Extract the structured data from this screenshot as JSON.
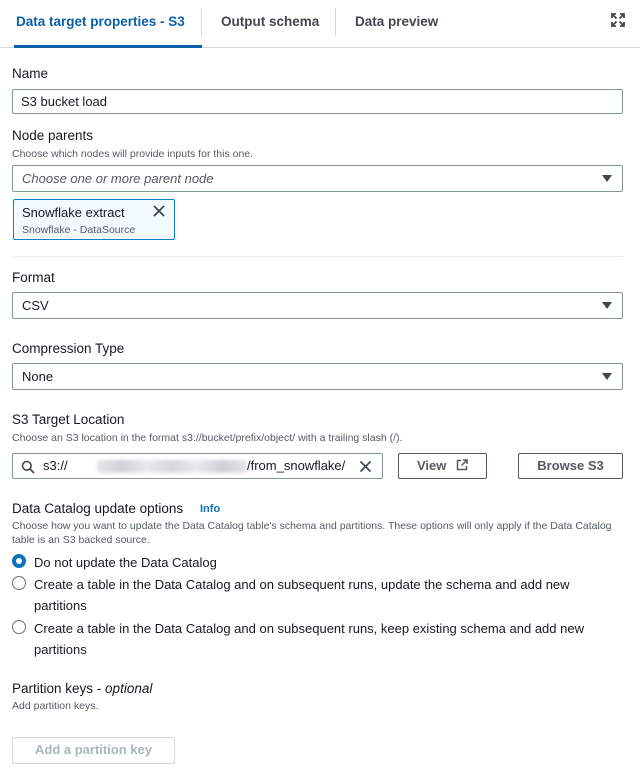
{
  "tabs": [
    {
      "label": "Data target properties - S3",
      "active": true
    },
    {
      "label": "Output schema",
      "active": false
    },
    {
      "label": "Data preview",
      "active": false
    }
  ],
  "icons": {
    "expand": "expand-icon",
    "close": "close-icon",
    "caret": "caret-down-icon",
    "search": "search-icon",
    "external": "external-link-icon"
  },
  "name": {
    "label": "Name",
    "value": "S3 bucket load"
  },
  "node_parents": {
    "label": "Node parents",
    "description": "Choose which nodes will provide inputs for this one.",
    "placeholder": "Choose one or more parent node",
    "token": {
      "title": "Snowflake extract",
      "subtitle": "Snowflake - DataSource"
    }
  },
  "format": {
    "label": "Format",
    "value": "CSV"
  },
  "compression": {
    "label": "Compression Type",
    "value": "None"
  },
  "s3_target": {
    "label": "S3 Target Location",
    "description": "Choose an S3 location in the format s3://bucket/prefix/object/ with a trailing slash (/).",
    "value_prefix": "s3://",
    "value_suffix": "/from_snowflake/",
    "view_button": "View",
    "browse_button": "Browse S3"
  },
  "catalog": {
    "label": "Data Catalog update options",
    "info": "Info",
    "description": "Choose how you want to update the Data Catalog table's schema and partitions. These options will only apply if the Data Catalog table is an S3 backed source.",
    "options": [
      {
        "label": "Do not update the Data Catalog",
        "checked": true
      },
      {
        "label": "Create a table in the Data Catalog and on subsequent runs, update the schema and add new partitions",
        "checked": false
      },
      {
        "label": "Create a table in the Data Catalog and on subsequent runs, keep existing schema and add new partitions",
        "checked": false
      }
    ]
  },
  "partition": {
    "label": "Partition keys",
    "optional": "optional",
    "description": "Add partition keys.",
    "add_button": "Add a partition key"
  },
  "colors": {
    "accent": "#0b5ea8",
    "token_border": "#0b7fc7",
    "token_bg": "#f1faff",
    "radio_checked": "#0b73bb"
  }
}
